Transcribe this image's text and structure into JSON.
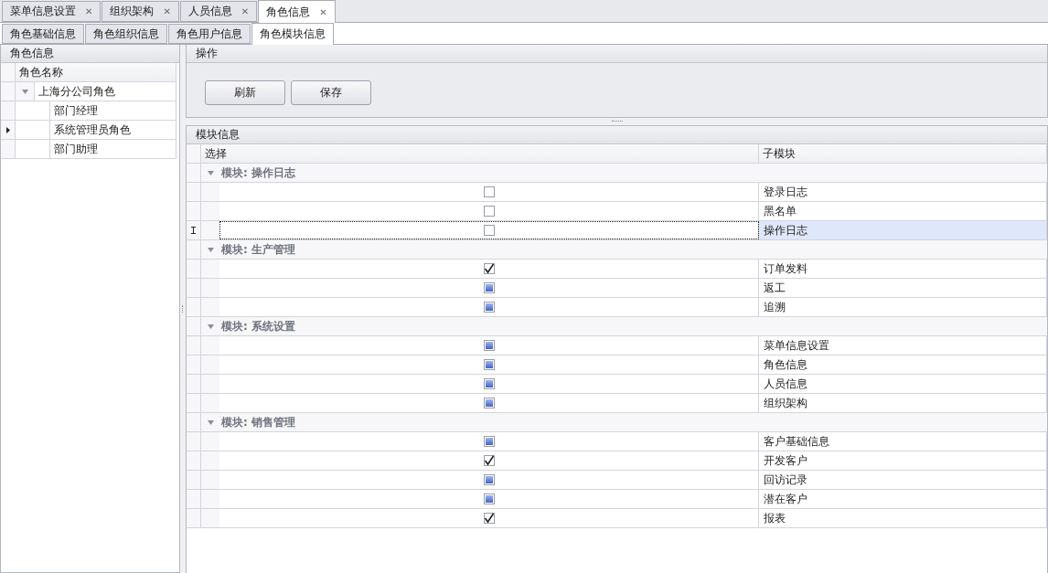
{
  "doc_tabs": [
    {
      "label": "菜单信息设置",
      "close": "✕",
      "selected": false
    },
    {
      "label": "组织架构",
      "close": "✕",
      "selected": false
    },
    {
      "label": "人员信息",
      "close": "✕",
      "selected": false
    },
    {
      "label": "角色信息",
      "close": "✕",
      "selected": true
    }
  ],
  "sub_tabs": [
    {
      "label": "角色基础信息",
      "selected": false
    },
    {
      "label": "角色组织信息",
      "selected": false
    },
    {
      "label": "角色用户信息",
      "selected": false
    },
    {
      "label": "角色模块信息",
      "selected": true
    }
  ],
  "role_panel": {
    "title": "角色信息",
    "column": "角色名称",
    "tree": [
      {
        "label": "上海分公司角色",
        "expanded": true,
        "focused": false,
        "children": [
          {
            "label": "部门经理",
            "focused": false
          },
          {
            "label": "系统管理员角色",
            "focused": true
          },
          {
            "label": "部门助理",
            "focused": false
          }
        ]
      }
    ]
  },
  "actions_panel": {
    "title": "操作",
    "buttons": [
      "刷新",
      "保存"
    ]
  },
  "module_panel": {
    "title": "模块信息",
    "columns": [
      "选择",
      "子模块"
    ],
    "groups": [
      {
        "label": "模块: 操作日志",
        "expanded": true,
        "rows": [
          {
            "checked": false,
            "indeterminate": false,
            "name": "登录日志",
            "focused": false
          },
          {
            "checked": false,
            "indeterminate": false,
            "name": "黑名单",
            "focused": false
          },
          {
            "checked": false,
            "indeterminate": false,
            "name": "操作日志",
            "focused": true
          }
        ]
      },
      {
        "label": "模块: 生产管理",
        "expanded": true,
        "rows": [
          {
            "checked": true,
            "indeterminate": false,
            "name": "订单发料",
            "focused": false
          },
          {
            "checked": false,
            "indeterminate": true,
            "name": "返工",
            "focused": false
          },
          {
            "checked": false,
            "indeterminate": true,
            "name": "追溯",
            "focused": false
          }
        ]
      },
      {
        "label": "模块: 系统设置",
        "expanded": true,
        "rows": [
          {
            "checked": false,
            "indeterminate": true,
            "name": "菜单信息设置",
            "focused": false
          },
          {
            "checked": false,
            "indeterminate": true,
            "name": "角色信息",
            "focused": false
          },
          {
            "checked": false,
            "indeterminate": true,
            "name": "人员信息",
            "focused": false
          },
          {
            "checked": false,
            "indeterminate": true,
            "name": "组织架构",
            "focused": false
          }
        ]
      },
      {
        "label": "模块: 销售管理",
        "expanded": true,
        "rows": [
          {
            "checked": false,
            "indeterminate": true,
            "name": "客户基础信息",
            "focused": false
          },
          {
            "checked": true,
            "indeterminate": false,
            "name": "开发客户",
            "focused": false
          },
          {
            "checked": false,
            "indeterminate": true,
            "name": "回访记录",
            "focused": false
          },
          {
            "checked": false,
            "indeterminate": true,
            "name": "潜在客户",
            "focused": false
          },
          {
            "checked": true,
            "indeterminate": false,
            "name": "报表",
            "focused": false
          }
        ]
      }
    ]
  }
}
